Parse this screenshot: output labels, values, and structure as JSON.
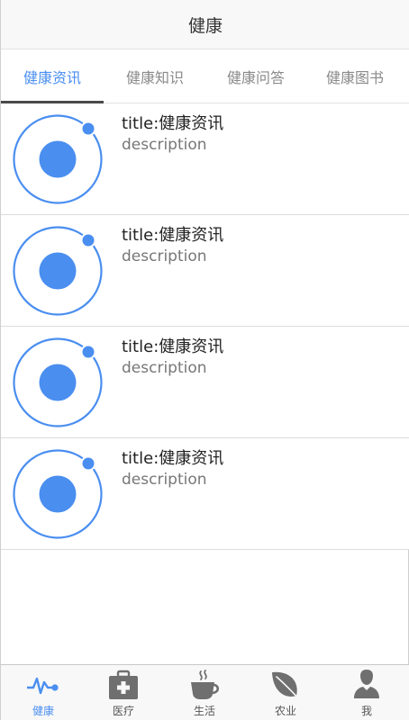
{
  "colors": {
    "accent": "#4a8ef0",
    "icon_gray": "#6f6f6f",
    "text": "#222222",
    "muted": "#777777"
  },
  "header": {
    "title": "健康"
  },
  "tabs": [
    {
      "label": "健康资讯",
      "active": true
    },
    {
      "label": "健康知识",
      "active": false
    },
    {
      "label": "健康问答",
      "active": false
    },
    {
      "label": "健康图书",
      "active": false
    }
  ],
  "items": [
    {
      "title": "title:健康资讯",
      "description": "description",
      "icon": "ionic-logo-icon"
    },
    {
      "title": "title:健康资讯",
      "description": "description",
      "icon": "ionic-logo-icon"
    },
    {
      "title": "title:健康资讯",
      "description": "description",
      "icon": "ionic-logo-icon"
    },
    {
      "title": "title:健康资讯",
      "description": "description",
      "icon": "ionic-logo-icon"
    }
  ],
  "tabbar": [
    {
      "label": "健康",
      "icon": "pulse-icon",
      "active": true
    },
    {
      "label": "医疗",
      "icon": "medkit-icon",
      "active": false
    },
    {
      "label": "生活",
      "icon": "cafe-icon",
      "active": false
    },
    {
      "label": "农业",
      "icon": "leaf-icon",
      "active": false
    },
    {
      "label": "我",
      "icon": "person-icon",
      "active": false
    }
  ]
}
